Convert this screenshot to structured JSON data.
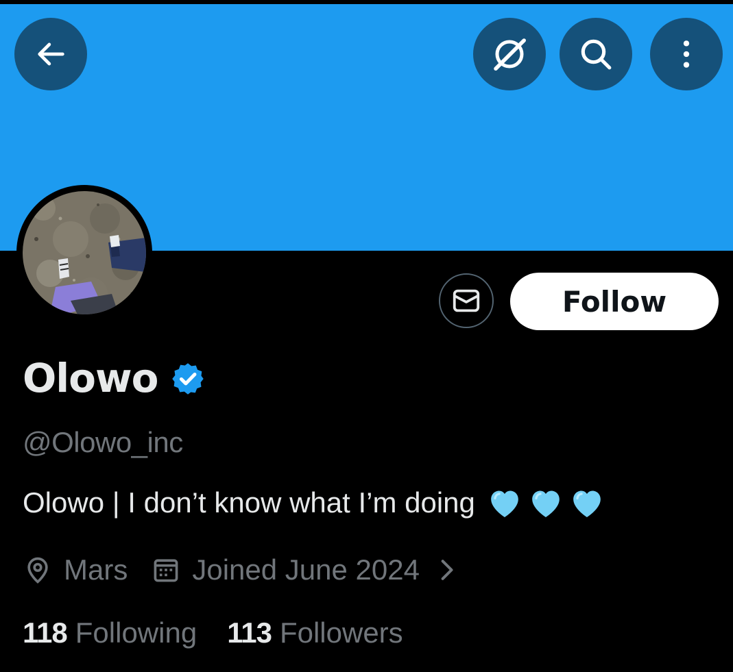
{
  "colors": {
    "banner": "#1d9bf0",
    "background": "#000000",
    "primary_text": "#e7e9ea",
    "secondary_text": "#71767b",
    "verified_badge": "#1d9bf0",
    "follow_button_bg": "#ffffff",
    "heart": "#74d0f5"
  },
  "header": {
    "icons": [
      "arrow-left-icon",
      "grok-icon",
      "search-icon",
      "more-vertical-icon"
    ]
  },
  "profile": {
    "display_name": "Olowo",
    "verified": true,
    "handle": "@Olowo_inc",
    "bio": "Olowo | I don’t know what I’m doing",
    "bio_emoji": [
      "light-blue-heart",
      "light-blue-heart",
      "light-blue-heart"
    ],
    "location": "Mars",
    "joined": "Joined June 2024"
  },
  "actions": {
    "follow_label": "Follow",
    "message_icon": "envelope-icon"
  },
  "stats": {
    "following_count": "118",
    "following_label": "Following",
    "followers_count": "113",
    "followers_label": "Followers"
  }
}
